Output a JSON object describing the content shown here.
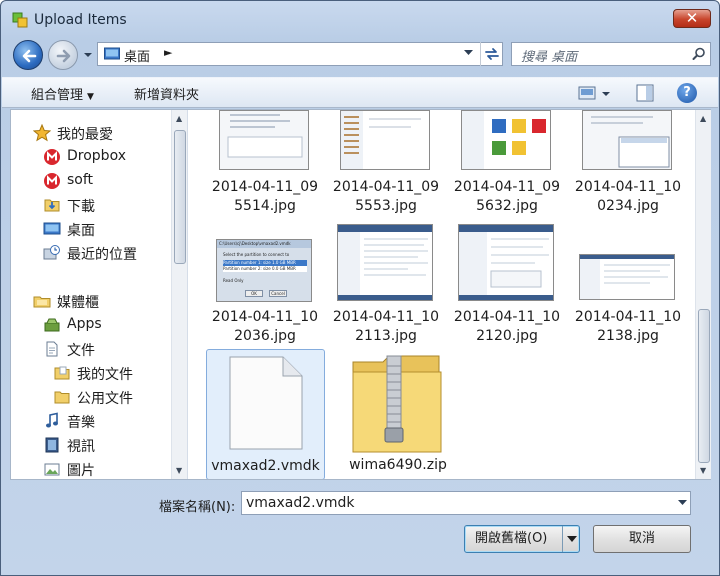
{
  "window": {
    "title": "Upload Items"
  },
  "address": {
    "crumbs": [
      "桌面"
    ]
  },
  "search": {
    "placeholder": "搜尋 桌面"
  },
  "toolbar": {
    "organize_label": "組合管理",
    "new_folder_label": "新增資料夾"
  },
  "nav": {
    "favorites_header": "我的最愛",
    "favorites": [
      "Dropbox",
      "soft",
      "下載",
      "桌面",
      "最近的位置"
    ],
    "libraries_header": "媒體櫃",
    "libraries": [
      "Apps",
      "文件",
      "我的文件",
      "公用文件",
      "音樂",
      "視訊",
      "圖片"
    ]
  },
  "files": [
    {
      "line1": "2014-04-11_09",
      "line2": "5514.jpg"
    },
    {
      "line1": "2014-04-11_09",
      "line2": "5553.jpg"
    },
    {
      "line1": "2014-04-11_09",
      "line2": "5632.jpg"
    },
    {
      "line1": "2014-04-11_10",
      "line2": "0234.jpg"
    },
    {
      "line1": "2014-04-11_10",
      "line2": "2036.jpg"
    },
    {
      "line1": "2014-04-11_10",
      "line2": "2113.jpg"
    },
    {
      "line1": "2014-04-11_10",
      "line2": "2120.jpg"
    },
    {
      "line1": "2014-04-11_10",
      "line2": "2138.jpg"
    },
    {
      "line1": "vmaxad2.vmdk"
    },
    {
      "line1": "wima6490.zip"
    }
  ],
  "dialog_thumb": {
    "path": "C:\\Users\\cj\\Desktop\\vmaxad2.vmdk",
    "prompt": "Select the partition to connect to",
    "option1": "Partition number 1: size 1.0 GB MBR",
    "option2": "Partition number 2: size 0.0 GB MBR",
    "readonly": "Read Only",
    "ok": "OK",
    "cancel": "Cancel"
  },
  "filename": {
    "label": "檔案名稱(N):",
    "value": "vmaxad2.vmdk"
  },
  "buttons": {
    "open_label": "開啟舊檔(O)",
    "cancel_label": "取消"
  },
  "colors": {
    "accent": "#3c7fb1",
    "close": "#c8452c",
    "selection": "#e2eefb"
  }
}
